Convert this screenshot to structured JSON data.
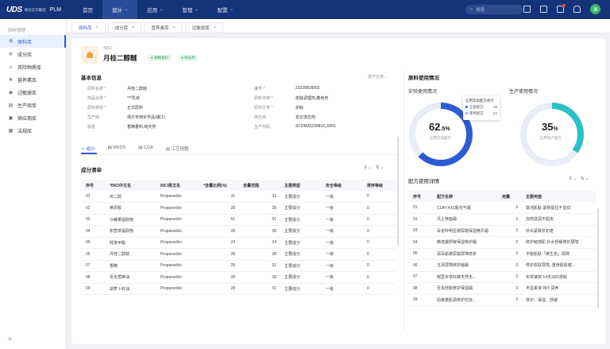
{
  "brand": {
    "logo": "UDS",
    "subtitle": "联合信华集团",
    "product": "PLM"
  },
  "nav": [
    {
      "label": "首页",
      "has_menu": false,
      "active": false
    },
    {
      "label": "设计",
      "has_menu": true,
      "active": true
    },
    {
      "label": "应用",
      "has_menu": true,
      "active": false
    },
    {
      "label": "管理",
      "has_menu": true,
      "active": false
    },
    {
      "label": "配置",
      "has_menu": true,
      "active": false
    }
  ],
  "search": {
    "placeholder": "搜索"
  },
  "user": {
    "avatar": "演"
  },
  "sidebar": {
    "title": "原料管理",
    "items": [
      {
        "label": "原料库",
        "icon": "flask-icon",
        "glyph": "⚗",
        "active": true
      },
      {
        "label": "成分库",
        "icon": "molecule-icon",
        "glyph": "✣",
        "active": false
      },
      {
        "label": "风险物质库",
        "icon": "warning-icon",
        "glyph": "⚠",
        "active": false
      },
      {
        "label": "营养素库",
        "icon": "leaf-icon",
        "glyph": "❦",
        "active": false
      },
      {
        "label": "过敏原库",
        "icon": "alert-icon",
        "glyph": "◉",
        "active": false
      },
      {
        "label": "生产商库",
        "icon": "factory-icon",
        "glyph": "▤",
        "active": false
      },
      {
        "label": "供应商库",
        "icon": "truck-icon",
        "glyph": "▣",
        "active": false
      },
      {
        "label": "法规库",
        "icon": "book-icon",
        "glyph": "▦",
        "active": false
      }
    ]
  },
  "tabs": [
    {
      "label": "原料库",
      "active": true
    },
    {
      "label": "成分库",
      "active": false
    },
    {
      "label": "营养素库",
      "active": false
    },
    {
      "label": "过敏原库",
      "active": false
    }
  ],
  "material": {
    "code": "4002",
    "name": "月桂二醇醚",
    "badges": [
      "● 香精香料",
      "● 纯天然"
    ]
  },
  "basic_info": {
    "title": "基本信息",
    "expand_label": "展开全部",
    "left": [
      {
        "k": "原料名称 *",
        "v": "月桂二醇醚"
      },
      {
        "k": "商品名称 *",
        "v": "***乳液"
      },
      {
        "k": "原料类别 *",
        "v": "正式原料"
      },
      {
        "k": "生产商",
        "v": "扬尔专用化学品(镇江)"
      },
      {
        "k": "标签",
        "v": "香精香料,纯天然"
      }
    ],
    "right": [
      {
        "k": "编号 *",
        "v": "23230816002"
      },
      {
        "k": "原料作用 *",
        "v": "皮肤调理剂,着色剂"
      },
      {
        "k": "原料分类 *",
        "v": "护肤"
      },
      {
        "k": "供应商",
        "v": "龙达供应商"
      },
      {
        "k": "生产代码",
        "v": "SCDM20230816_0001"
      }
    ]
  },
  "subtabs": [
    {
      "label": "⚛ 成分",
      "active": true
    },
    {
      "label": "▤ MSDS",
      "active": false
    },
    {
      "label": "▤ COA",
      "active": false
    },
    {
      "label": "▤ 工艺规程",
      "active": false
    }
  ],
  "composition": {
    "title": "成分清单",
    "headers": [
      "序号",
      "*INCI中文名",
      "INCI英文名",
      "*含量比例(%)",
      "含量范围",
      "主要类型",
      "安全等级",
      "排序等级"
    ],
    "rows": [
      [
        "01",
        "丙二醇",
        "Propanedioi",
        "31",
        "31",
        "主要成分",
        "一级",
        "0"
      ],
      [
        "02",
        "黄原胶",
        "Propanedioi",
        "28",
        "28",
        "主要成分",
        "一级",
        "0"
      ],
      [
        "03",
        "沙棘果提取物",
        "Propanedioi",
        "51",
        "51",
        "主要成分",
        "一级",
        "0"
      ],
      [
        "04",
        "积雪草提取物",
        "Propanedioi",
        "28",
        "28",
        "主要成分",
        "一级",
        "0"
      ],
      [
        "05",
        "羟苯甲酯",
        "Propanedioi",
        "24",
        "24",
        "主要成分",
        "一级",
        "0"
      ],
      [
        "06",
        "月桂二醇醚",
        "Propanedioi",
        "28",
        "28",
        "主要成分",
        "一级",
        "0"
      ],
      [
        "07",
        "香精",
        "Propanedioi",
        "28",
        "51",
        "主要成分",
        "一级",
        "0"
      ],
      [
        "08",
        "氢化蓖麻油",
        "Propanedioi",
        "28",
        "28",
        "主要成分",
        "一级",
        "0"
      ],
      [
        "09",
        "胡萝卜籽油",
        "Propanedioi",
        "28",
        "51",
        "主要成分",
        "一级",
        "0"
      ]
    ]
  },
  "usage": {
    "title": "原料使用情况",
    "lab": {
      "label": "实验使用情况",
      "pct": "62",
      "pct_decimal": ".5",
      "sub": "应用实验配方",
      "value": 0.625,
      "color": "#2d5bd6"
    },
    "prod": {
      "label": "生产使用情况",
      "pct": "35",
      "sub": "应用生产配方",
      "value": 0.35,
      "color": "#2bc0c8"
    },
    "tooltip": {
      "title": "应用实验配方统计",
      "rows": [
        {
          "name": "全部配方",
          "value": "15",
          "color": "#2d5bd6"
        },
        {
          "name": "使用配方",
          "value": "24",
          "color": "#9ab0e8"
        }
      ]
    }
  },
  "formula": {
    "title": "配方使用详情",
    "headers": [
      "序号",
      "配方名称",
      "用量",
      "主要用途"
    ],
    "rows": [
      [
        "01",
        "CLAY大红瓶空气霜",
        "3",
        "激活肌肤 紧致提拉不显纹"
      ],
      [
        "02",
        "凡士林面霜",
        "3",
        "加倍滋润不起皮"
      ],
      [
        "03",
        "百雀羚明星玻尿酸保湿精华霜",
        "3",
        "补水紧致抗初老"
      ],
      [
        "04",
        "薇诺娜舒敏保湿特护霜",
        "3",
        "修护敏感肌 补水舒缓修护屏障"
      ],
      [
        "05",
        "润百颜玻尿酸屏障修护",
        "3",
        "平衡肌肤「微生态」屏障"
      ],
      [
        "06",
        "玉泽屏障修护面霜",
        "3",
        "修护皮肤屏障, 重焕肌肤健..."
      ],
      [
        "07",
        "郁里本草红蜂天然无...",
        "3",
        "实效速效 14天淡红皮肤"
      ],
      [
        "08",
        "至本舒颜修护保湿霜",
        "3",
        "丰盈柔滑 持久润养"
      ],
      [
        "09",
        "珀莱雅肌源修护优效...",
        "3",
        "修护、保湿、舒缓"
      ]
    ]
  }
}
